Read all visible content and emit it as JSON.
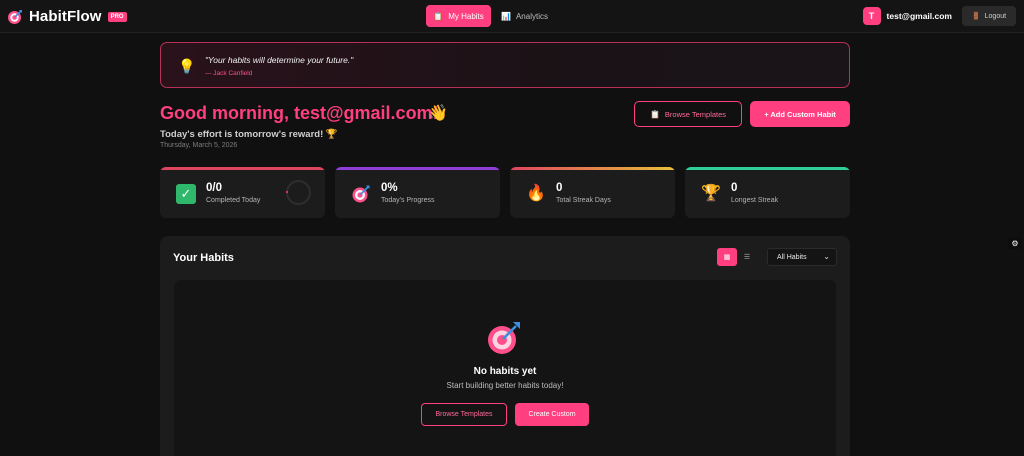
{
  "nav": {
    "brand": "HabitFlow",
    "badge": "PRO",
    "tabs": [
      {
        "label": "My Habits",
        "icon": "clipboard-icon",
        "active": true
      },
      {
        "label": "Analytics",
        "icon": "bar-chart-icon",
        "active": false
      }
    ],
    "user_initial": "T",
    "user_email": "test@gmail.com",
    "logout_label": "Logout"
  },
  "quote": {
    "text": "\"Your habits will determine your future.\"",
    "author": "— Jack Canfield"
  },
  "greeting": {
    "title": "Good morning, test@gmail.com!",
    "subtitle": "Today's effort is tomorrow's reward! 🏆",
    "date": "Thursday, March 5, 2026",
    "browse_label": "Browse Templates",
    "add_label": "+ Add Custom Habit"
  },
  "stats": [
    {
      "value": "0/0",
      "label": "Completed Today",
      "icon": "check-icon",
      "color": "#e0455f"
    },
    {
      "value": "0%",
      "label": "Today's Progress",
      "icon": "target-icon",
      "color": "#8e3fd6"
    },
    {
      "value": "0",
      "label": "Total Streak Days",
      "icon": "fire-icon",
      "color": "#e7a13a"
    },
    {
      "value": "0",
      "label": "Longest Streak",
      "icon": "trophy-icon",
      "color": "#2ecf9a"
    }
  ],
  "habits": {
    "title": "Your Habits",
    "filter_value": "All Habits",
    "empty_title": "No habits yet",
    "empty_subtitle": "Start building better habits today!",
    "browse_label": "Browse Templates",
    "create_label": "Create Custom"
  },
  "colors": {
    "accent": "#ff3f7f",
    "background": "#101010",
    "card": "#1c1c1c"
  }
}
